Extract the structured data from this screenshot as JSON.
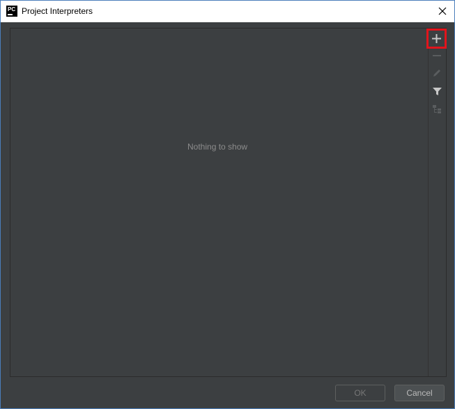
{
  "window": {
    "title": "Project Interpreters",
    "app_logo_text": "PC"
  },
  "list": {
    "empty_message": "Nothing to show"
  },
  "toolbar": {
    "icons": [
      "add-icon",
      "remove-icon",
      "edit-icon",
      "filter-icon",
      "show-paths-icon"
    ]
  },
  "footer": {
    "ok_label": "OK",
    "cancel_label": "Cancel"
  },
  "colors": {
    "highlight": "#e2141c",
    "panel_bg": "#3c3f41"
  }
}
